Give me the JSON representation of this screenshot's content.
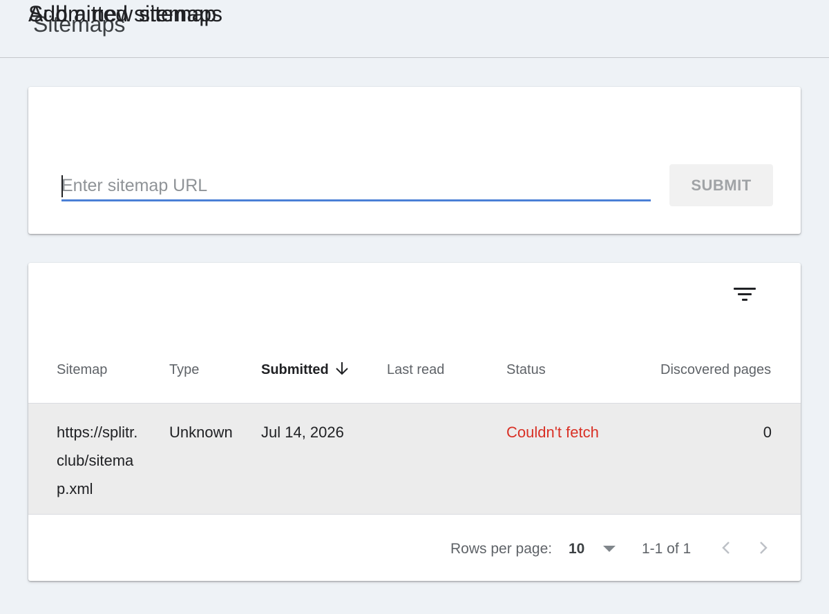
{
  "page": {
    "title": "Sitemaps"
  },
  "add_sitemap": {
    "title": "Add a new sitemap",
    "input_placeholder": "Enter sitemap URL",
    "input_value": "",
    "submit_label": "SUBMIT"
  },
  "submitted": {
    "title": "Submitted sitemaps",
    "columns": [
      "Sitemap",
      "Type",
      "Submitted",
      "Last read",
      "Status",
      "Discovered pages"
    ],
    "sorted_column": "Submitted",
    "sort_direction": "descending",
    "rows": [
      {
        "sitemap": "https://splitr.club/sitemap.xml",
        "type": "Unknown",
        "submitted": "Jul 14, 2026",
        "last_read": "",
        "status": "Couldn't fetch",
        "discovered_pages": "0"
      }
    ],
    "pagination": {
      "rows_per_page_label": "Rows per page:",
      "rows_per_page": "10",
      "range": "1-1 of 1"
    }
  },
  "colors": {
    "page_background": "#eef2f6",
    "input_underline": "#4a7fd6",
    "error_status": "#d93025",
    "row_background": "#ececec"
  },
  "icons": [
    "filter-icon",
    "arrow-down-icon",
    "dropdown-arrow-icon",
    "chevron-left-icon",
    "chevron-right-icon"
  ]
}
